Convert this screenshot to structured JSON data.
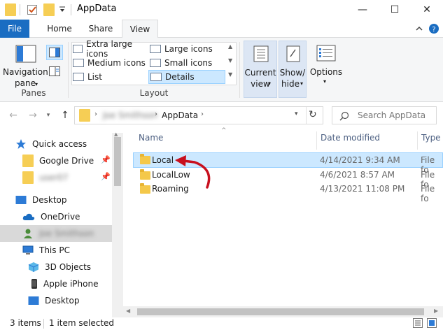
{
  "window": {
    "title": "AppData",
    "minimize_glyph": "—",
    "maximize_glyph": "☐",
    "close_glyph": "✕"
  },
  "tabs": {
    "file": "File",
    "home": "Home",
    "share": "Share",
    "view": "View"
  },
  "ribbon": {
    "panes": {
      "navigation_pane": "Navigation",
      "navigation_pane_line2": "pane",
      "group_label": "Panes"
    },
    "layout": {
      "extra_large": "Extra large icons",
      "large": "Large icons",
      "medium": "Medium icons",
      "small": "Small icons",
      "list": "List",
      "details": "Details",
      "group_label": "Layout"
    },
    "current_view": "Current",
    "current_view_line2": "view",
    "show_hide": "Show/",
    "show_hide_line2": "hide",
    "options": "Options"
  },
  "address": {
    "user_crumb": "Joe Smithson",
    "current": "AppData",
    "search_placeholder": "Search AppData"
  },
  "nav": {
    "quick_access": "Quick access",
    "google_drive": "Google Drive",
    "user_folder": "user07",
    "desktop": "Desktop",
    "onedrive": "OneDrive",
    "user": "Joe Smithson",
    "this_pc": "This PC",
    "objects_3d": "3D Objects",
    "iphone": "Apple iPhone",
    "desktop2": "Desktop"
  },
  "columns": {
    "name": "Name",
    "date": "Date modified",
    "type": "Type"
  },
  "files": [
    {
      "name": "Local",
      "date": "4/14/2021 9:34 AM",
      "type": "File fo"
    },
    {
      "name": "LocalLow",
      "date": "4/6/2021 8:57 AM",
      "type": "File fo"
    },
    {
      "name": "Roaming",
      "date": "4/13/2021 11:08 PM",
      "type": "File fo"
    }
  ],
  "status": {
    "count": "3 items",
    "selected": "1 item selected"
  },
  "colors": {
    "accent": "#1a6dc2",
    "selection": "#cce8ff",
    "arrow": "#c8101e"
  }
}
